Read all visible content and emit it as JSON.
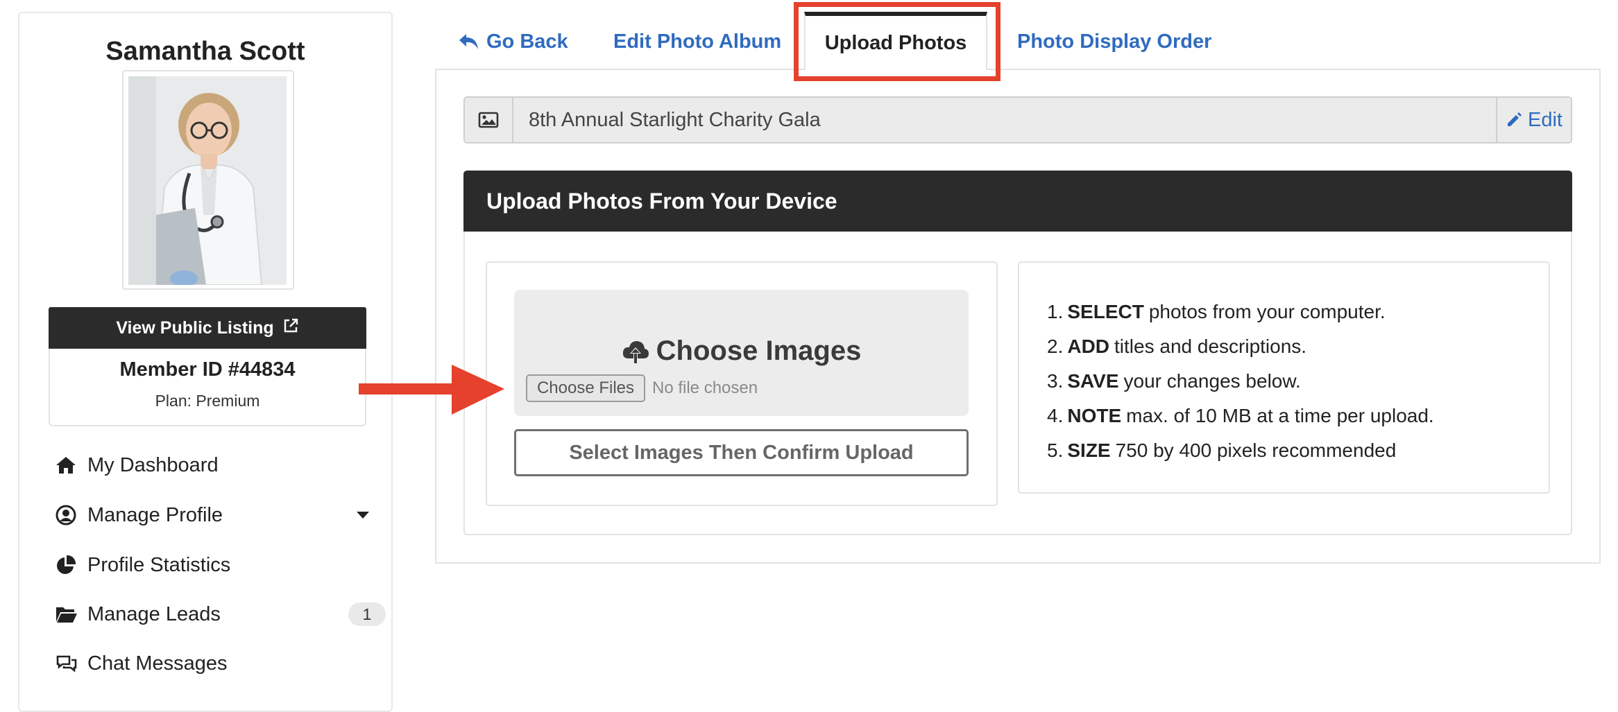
{
  "sidebar": {
    "member_name": "Samantha Scott",
    "view_listing_label": "View Public Listing",
    "member_id": "Member ID #44834",
    "plan": "Plan: Premium",
    "nav": [
      {
        "label": "My Dashboard",
        "icon": "home-icon"
      },
      {
        "label": "Manage Profile",
        "icon": "user-circle-icon"
      },
      {
        "label": "Profile Statistics",
        "icon": "pie-chart-icon"
      },
      {
        "label": "Manage Leads",
        "icon": "folder-open-icon",
        "badge": "1"
      },
      {
        "label": "Chat Messages",
        "icon": "chat-icon"
      }
    ]
  },
  "tabs": {
    "go_back": "Go Back",
    "edit_album": "Edit Photo Album",
    "upload_photos": "Upload Photos",
    "display_order": "Photo Display Order"
  },
  "album": {
    "title": "8th Annual Starlight Charity Gala",
    "edit_label": "Edit"
  },
  "upload": {
    "header": "Upload Photos From Your Device",
    "choose_title": "Choose Images",
    "file_button": "Choose Files",
    "file_status": "No file chosen",
    "confirm_label": "Select Images Then Confirm Upload"
  },
  "instructions": [
    {
      "num": "1.",
      "key": "SELECT",
      "text": "photos from your computer."
    },
    {
      "num": "2.",
      "key": "ADD",
      "text": "titles and descriptions."
    },
    {
      "num": "3.",
      "key": "SAVE",
      "text": "your changes below."
    },
    {
      "num": "4.",
      "key": "NOTE",
      "text": "max. of 10 MB at a time per upload."
    },
    {
      "num": "5.",
      "key": "SIZE",
      "text": "750 by 400 pixels recommended"
    }
  ],
  "colors": {
    "link_blue": "#2f6bbf",
    "dark_header": "#2b2b2b",
    "annotation_red": "#e5412c"
  }
}
